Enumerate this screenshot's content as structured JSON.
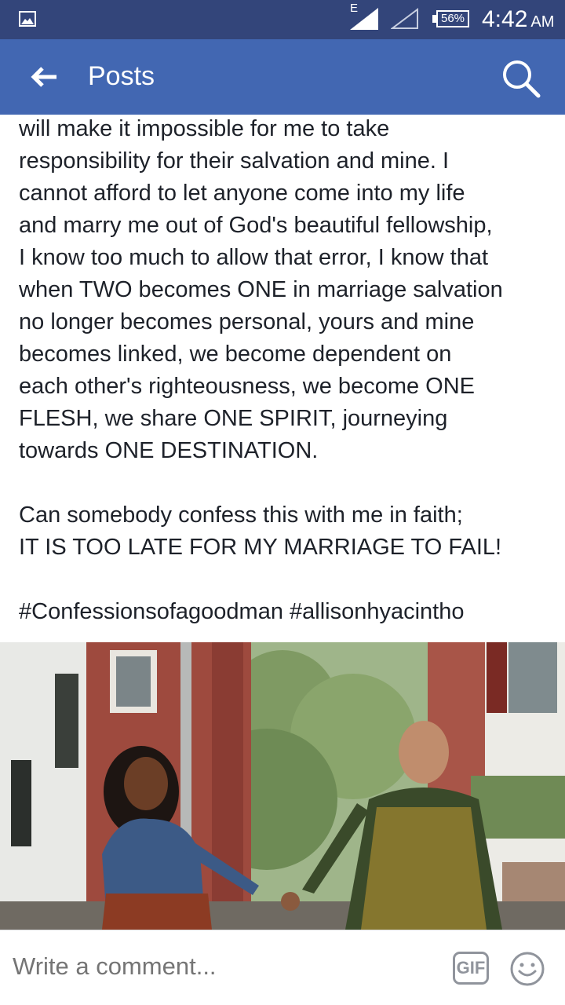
{
  "status_bar": {
    "network_type": "E",
    "battery": "56%",
    "time": "4:42",
    "ampm": "AM"
  },
  "app_bar": {
    "title": "Posts"
  },
  "post": {
    "paragraph_1": "will make it impossible for me to take\nresponsibility for their salvation and mine. I\ncannot afford to let anyone come into my life\nand marry me out of God's beautiful fellowship,\nI know too much to allow that error, I know that\nwhen TWO becomes ONE in marriage salvation\nno longer becomes personal, yours and mine\nbecomes linked, we become dependent on\neach other's righteousness, we become ONE\nFLESH, we share ONE SPIRIT,  journeying\ntowards ONE DESTINATION.",
    "paragraph_2": "Can somebody confess this with me in faith;\n IT IS TOO LATE FOR MY MARRIAGE TO FAIL!",
    "hashtags": "#Confessionsofagoodman #allisonhyacintho"
  },
  "comment_bar": {
    "placeholder": "Write a comment...",
    "gif_label": "GIF"
  },
  "icons": {
    "back": "arrow-left-icon",
    "search": "search-icon",
    "emoji": "smiley-icon",
    "gallery": "image-icon"
  },
  "colors": {
    "status_bar": "#33457a",
    "app_bar": "#4267b2",
    "text": "#1d2129",
    "muted": "#90949c"
  }
}
